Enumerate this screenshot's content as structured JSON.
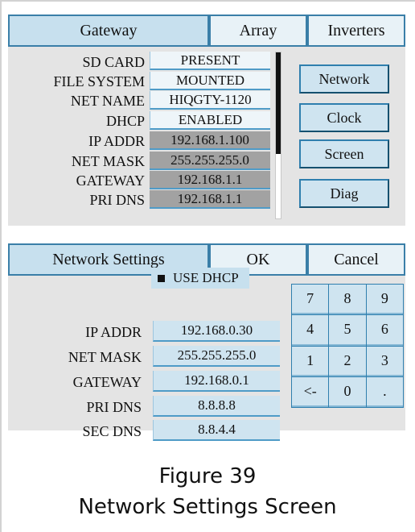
{
  "gateway_panel": {
    "tabs": [
      "Gateway",
      "Array",
      "Inverters"
    ],
    "rows": [
      {
        "label": "SD CARD",
        "value": "PRESENT"
      },
      {
        "label": "FILE SYSTEM",
        "value": "MOUNTED"
      },
      {
        "label": "NET NAME",
        "value": "HIQGTY-1120"
      },
      {
        "label": "DHCP",
        "value": "ENABLED"
      },
      {
        "label": "IP ADDR",
        "value": "192.168.1.100"
      },
      {
        "label": "NET MASK",
        "value": "255.255.255.0"
      },
      {
        "label": "GATEWAY",
        "value": "192.168.1.1"
      },
      {
        "label": "PRI DNS",
        "value": "192.168.1.1"
      }
    ],
    "buttons": [
      "Network",
      "Clock",
      "Screen",
      "Diag"
    ]
  },
  "network_panel": {
    "tabs": [
      "Network Settings",
      "OK",
      "Cancel"
    ],
    "dhcp_label": "USE DHCP",
    "fields": [
      {
        "label": "IP ADDR",
        "value": "192.168.0.30"
      },
      {
        "label": "NET MASK",
        "value": "255.255.255.0"
      },
      {
        "label": "GATEWAY",
        "value": "192.168.0.1"
      },
      {
        "label": "PRI DNS",
        "value": "8.8.8.8"
      },
      {
        "label": "SEC DNS",
        "value": "8.8.4.4"
      }
    ],
    "keypad": [
      "7",
      "8",
      "9",
      "4",
      "5",
      "6",
      "1",
      "2",
      "3",
      "<-",
      "0",
      "."
    ]
  },
  "caption": {
    "figure": "Figure 39",
    "title": "Network Settings Screen"
  }
}
